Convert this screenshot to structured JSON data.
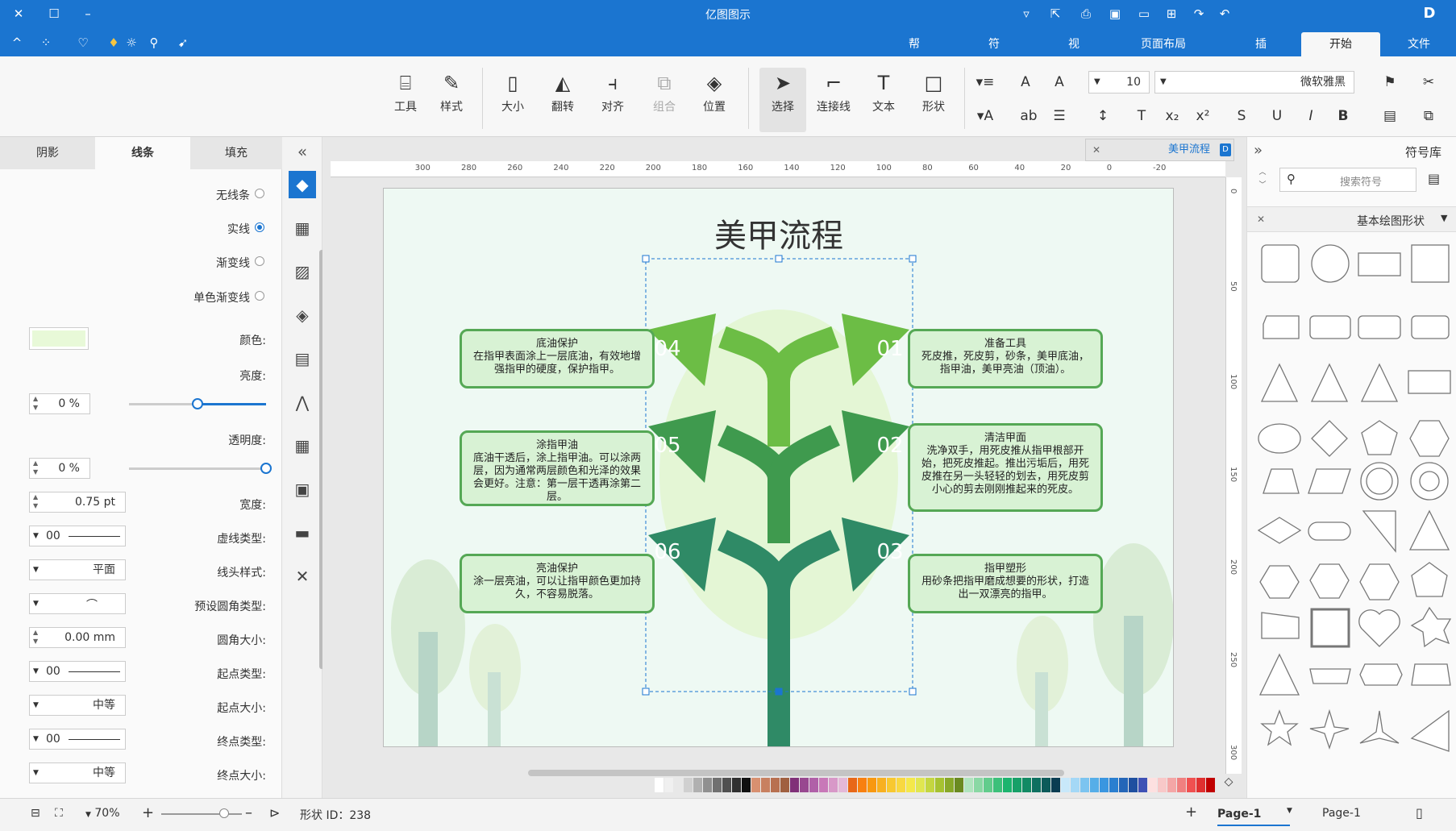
{
  "window": {
    "title": "亿图图示"
  },
  "menu": {
    "tabs": [
      "文件",
      "开始",
      "插入",
      "页面布局",
      "视图",
      "符号",
      "帮助"
    ],
    "active": "开始"
  },
  "ribbon": {
    "font_name": "微软雅黑",
    "font_size": "10",
    "tools": {
      "shape": "形状",
      "text": "文本",
      "connector": "连接线",
      "select": "选择",
      "position": "位置",
      "group": "组合",
      "align": "对齐",
      "flip": "翻转",
      "size": "大小",
      "style": "样式",
      "tools": "工具"
    }
  },
  "doc_tab": {
    "name": "美甲流程"
  },
  "ruler": {
    "h_ticks": [
      "-20",
      "0",
      "20",
      "40",
      "60",
      "80",
      "100",
      "120",
      "140",
      "160",
      "180",
      "200",
      "220",
      "240",
      "260",
      "280",
      "300"
    ],
    "v_ticks": [
      "0",
      "50",
      "100",
      "150",
      "200",
      "250",
      "300"
    ]
  },
  "diagram": {
    "title": "美甲流程",
    "steps": [
      {
        "num": "01",
        "title": "准备工具",
        "body": "死皮推，死皮剪，砂条，美甲底油，指甲油，美甲亮油（顶油）。"
      },
      {
        "num": "02",
        "title": "清洁甲面",
        "body": "洗净双手，用死皮推从指甲根部开始，把死皮推起。推出污垢后，用死皮推在另一头轻轻的划去，用死皮剪小心的剪去刚刚推起来的死皮。"
      },
      {
        "num": "03",
        "title": "指甲塑形",
        "body": "用砂条把指甲磨成想要的形状，打造出一双漂亮的指甲。"
      },
      {
        "num": "04",
        "title": "底油保护",
        "body": "在指甲表面涂上一层底油，有效地增强指甲的硬度，保护指甲。"
      },
      {
        "num": "05",
        "title": "涂指甲油",
        "body": "底油干透后，涂上指甲油。可以涂两层，因为通常两层颜色和光泽的效果会更好。注意：第一层干透再涂第二层。"
      },
      {
        "num": "06",
        "title": "亮油保护",
        "body": "涂一层亮油，可以让指甲颜色更加持久，不容易脱落。"
      }
    ]
  },
  "props": {
    "tabs": [
      "填充",
      "线条",
      "阴影"
    ],
    "active_tab": "线条",
    "line_options": [
      "无线条",
      "实线",
      "渐变线",
      "单色渐变线"
    ],
    "selected_option": "实线",
    "labels": {
      "color": "颜色:",
      "brightness": "亮度:",
      "transparency": "透明度:",
      "width": "宽度:",
      "dash": "虚线类型:",
      "cap": "线头样式:",
      "corner": "预设圆角类型:",
      "corner_size": "圆角大小:",
      "start_type": "起点类型:",
      "start_size": "起点大小:",
      "end_type": "终点类型:",
      "end_size": "终点大小:"
    },
    "values": {
      "color": "#e8f9d8",
      "brightness": "0 %",
      "brightness_level": 0.5,
      "transparency": "0 %",
      "transparency_level": 1.0,
      "width": "0.75 pt",
      "dash": "00",
      "cap": "平面",
      "corner_size": "0.00 mm",
      "start_type": "00",
      "start_size": "中等",
      "end_type": "00",
      "end_size": "中等"
    }
  },
  "symbol_library": {
    "title": "符号库",
    "search_placeholder": "搜索符号",
    "category": "基本绘图形状"
  },
  "status": {
    "shape_id": "形状 ID：238",
    "zoom": "70%",
    "page_tab": "Page-1",
    "page_sel": "Page-1"
  },
  "colors": {
    "accent": "#1b75d0",
    "card_fill": "#d8f2d4",
    "card_border": "#55a855",
    "arrow_light": "#6cbd45",
    "arrow_mid": "#3f9a4e",
    "arrow_dark": "#2f8a66"
  }
}
